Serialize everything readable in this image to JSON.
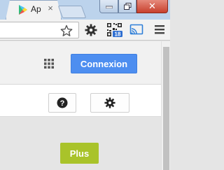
{
  "browser": {
    "tab": {
      "title": "Ap",
      "favicon": "play-store-icon",
      "close_glyph": "×"
    },
    "window_controls": {
      "close_glyph": "✕"
    },
    "toolbar_icons": [
      "star-icon",
      "gear-icon",
      "qr-extension-icon",
      "cast-extension-icon",
      "menu-icon"
    ],
    "extension_badge": "18"
  },
  "page": {
    "header": {
      "apps_icon": "apps-grid-icon",
      "login_label": "Connexion"
    },
    "action_bar": {
      "help_icon": "help-icon",
      "settings_icon": "gear-icon"
    },
    "more_label": "Plus"
  },
  "colors": {
    "login_blue": "#4d8ef0",
    "more_green": "#a9c32a",
    "tabstrip": "#bcd3ec"
  }
}
